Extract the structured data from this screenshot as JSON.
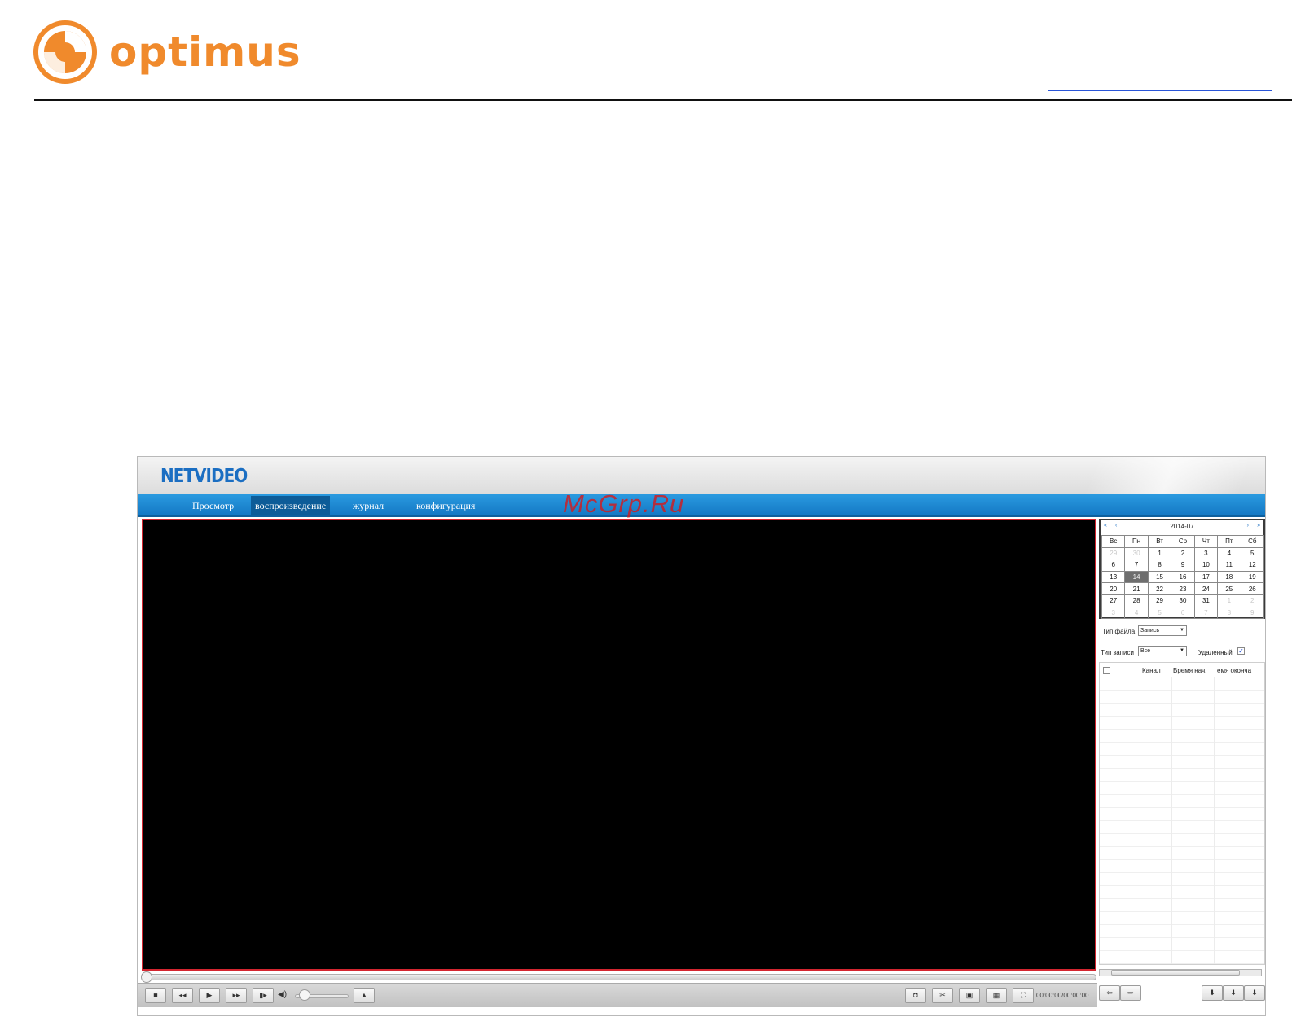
{
  "brand": {
    "name": "optimus",
    "accent_color": "#f08a2c"
  },
  "app": {
    "product": "NETVIDEO",
    "watermark": "McGrp.Ru",
    "nav": [
      {
        "label": "Просмотр",
        "active": false
      },
      {
        "label": "воспроизведение",
        "active": true
      },
      {
        "label": "журнал",
        "active": false
      },
      {
        "label": "конфигурация",
        "active": false
      }
    ]
  },
  "calendar": {
    "title": "2014-07",
    "prev_year_icon": "«",
    "prev_month_icon": "‹",
    "next_month_icon": "›",
    "next_year_icon": "»",
    "weekdays": [
      "Вс",
      "Пн",
      "Вт",
      "Ср",
      "Чт",
      "Пт",
      "Сб"
    ],
    "weeks": [
      [
        "29",
        "30",
        "1",
        "2",
        "3",
        "4",
        "5"
      ],
      [
        "6",
        "7",
        "8",
        "9",
        "10",
        "11",
        "12"
      ],
      [
        "13",
        "14",
        "15",
        "16",
        "17",
        "18",
        "19"
      ],
      [
        "20",
        "21",
        "22",
        "23",
        "24",
        "25",
        "26"
      ],
      [
        "27",
        "28",
        "29",
        "30",
        "31",
        "1",
        "2"
      ],
      [
        "3",
        "4",
        "5",
        "6",
        "7",
        "8",
        "9"
      ]
    ],
    "selected": "14"
  },
  "filters": {
    "file_type_label": "Тип файла",
    "file_type_value": "Запись",
    "record_type_label": "Тип записи",
    "record_type_value": "Все",
    "deleted_label": "Удаленный",
    "deleted_checked": true
  },
  "file_list": {
    "columns": [
      "Канал",
      "Время нач.",
      "емя оконча"
    ]
  },
  "controls": {
    "stop_icon": "■",
    "slow_icon": "◂◂",
    "play_icon": "▶",
    "fast_icon": "▸▸",
    "step_icon": "▮▸",
    "volume_icon": "◀)",
    "eject_icon": "▲",
    "snapshot_icon": "◘",
    "clip_icon": "✂",
    "single_view_icon": "▣",
    "quad_view_icon": "▦",
    "fullscreen_icon": "⛶",
    "time": "00:00:00/00:00:00",
    "prev_icon": "⇦",
    "next_icon": "⇨",
    "download_icon": "⬇",
    "download_by_time_icon": "⬇",
    "download_manager_icon": "⬇"
  }
}
